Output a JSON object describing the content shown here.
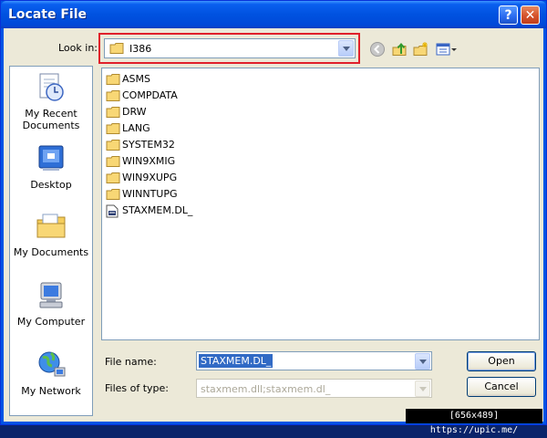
{
  "window": {
    "title": "Locate File"
  },
  "titlebar": {
    "help": "?",
    "close": "✕"
  },
  "lookin": {
    "label": "Look in:",
    "value": "I386"
  },
  "places": [
    {
      "label": "My Recent Documents",
      "icon": "recent-documents-icon"
    },
    {
      "label": "Desktop",
      "icon": "desktop-icon"
    },
    {
      "label": "My Documents",
      "icon": "my-documents-icon"
    },
    {
      "label": "My Computer",
      "icon": "my-computer-icon"
    },
    {
      "label": "My Network",
      "icon": "my-network-icon"
    }
  ],
  "files": [
    {
      "name": "ASMS",
      "type": "folder"
    },
    {
      "name": "COMPDATA",
      "type": "folder"
    },
    {
      "name": "DRW",
      "type": "folder"
    },
    {
      "name": "LANG",
      "type": "folder"
    },
    {
      "name": "SYSTEM32",
      "type": "folder"
    },
    {
      "name": "WIN9XMIG",
      "type": "folder"
    },
    {
      "name": "WIN9XUPG",
      "type": "folder"
    },
    {
      "name": "WINNTUPG",
      "type": "folder"
    },
    {
      "name": "STAXMEM.DL_",
      "type": "file"
    }
  ],
  "filename": {
    "label": "File name:",
    "value": "STAXMEM.DL_"
  },
  "filetype": {
    "label": "Files of type:",
    "value": "staxmem.dll;staxmem.dl_"
  },
  "buttons": {
    "open": "Open",
    "cancel": "Cancel"
  },
  "watermark": "[656x489] https://upic.me/",
  "colors": {
    "titlebar": "#0052e0",
    "highlight": "#e0202b",
    "selection": "#316ac5"
  }
}
